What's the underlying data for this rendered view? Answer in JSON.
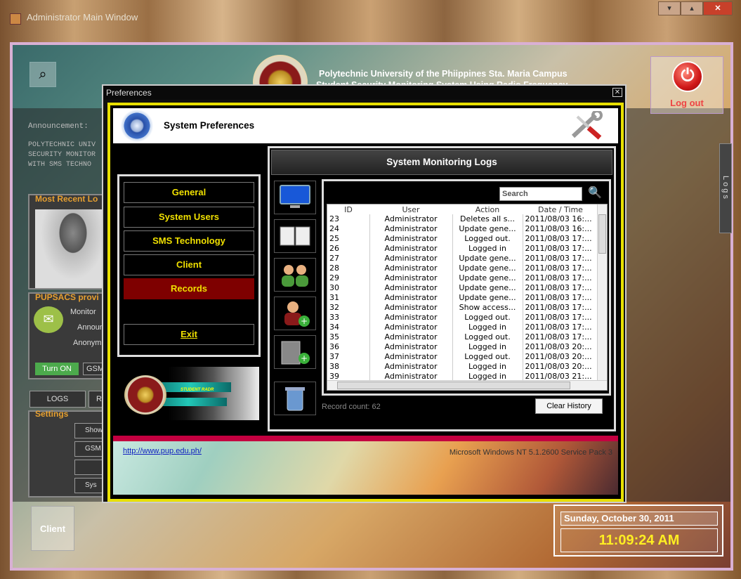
{
  "main_window": {
    "title": "Administrator Main Window",
    "controls": {
      "minimize": "▾",
      "maximize": "▴",
      "close": "✕"
    }
  },
  "header": {
    "line1": "Polytechnic University of the Phiippines Sta. Maria Campus",
    "line2": "Student Security Monitoring System Using Radio Frequency",
    "logout_label": "Log out",
    "logout_icon": "power-icon"
  },
  "left_panels": {
    "announcement_label": "Announcement:",
    "announcement_text": [
      "POLYTECHNIC UNIV",
      "SECURITY MONITOR",
      "WITH SMS TECHNO"
    ],
    "recent_title": "Most Recent Lo",
    "pupsacs_title": "PUPSACS provi",
    "pupsacs_labels": [
      "Monitor",
      "Announ",
      "Anonym"
    ],
    "turn_on_label": "Turn ON",
    "gsm_label": "GSM",
    "logs_tab": "LOGS",
    "r_tab": "R",
    "settings_title": "Settings",
    "settings_buttons": [
      "Show",
      "GSM M",
      "",
      "Sys"
    ]
  },
  "client_label": "Client",
  "logs_side_tab": "Logs",
  "clock": {
    "date": "Sunday, October 30, 2011",
    "time": "11:09:24 AM"
  },
  "preferences": {
    "title": "Preferences",
    "close_glyph": "✕",
    "header_title": "System Preferences",
    "menu": [
      {
        "label": "General",
        "active": false
      },
      {
        "label": "System Users",
        "active": false
      },
      {
        "label": "SMS Technology",
        "active": false
      },
      {
        "label": "Client",
        "active": false
      },
      {
        "label": "Records",
        "active": true
      }
    ],
    "exit_label": "Exit",
    "logo_caption": "STUDENT RADR",
    "logs_title": "System Monitoring Logs",
    "search_placeholder": "Search",
    "columns": [
      "ID",
      "User",
      "Action",
      "Date / Time"
    ],
    "rows": [
      [
        "23",
        "Administrator",
        "Deletes all s...",
        "2011/08/03 16:..."
      ],
      [
        "24",
        "Administrator",
        "Update gene...",
        "2011/08/03 16:..."
      ],
      [
        "25",
        "Administrator",
        "Logged out.",
        "2011/08/03 17:..."
      ],
      [
        "26",
        "Administrator",
        "Logged in",
        "2011/08/03 17:..."
      ],
      [
        "27",
        "Administrator",
        "Update gene...",
        "2011/08/03 17:..."
      ],
      [
        "28",
        "Administrator",
        "Update gene...",
        "2011/08/03 17:..."
      ],
      [
        "29",
        "Administrator",
        "Update gene...",
        "2011/08/03 17:..."
      ],
      [
        "30",
        "Administrator",
        "Update gene...",
        "2011/08/03 17:..."
      ],
      [
        "31",
        "Administrator",
        "Update gene...",
        "2011/08/03 17:..."
      ],
      [
        "32",
        "Administrator",
        "Show access...",
        "2011/08/03 17:..."
      ],
      [
        "33",
        "Administrator",
        "Logged out.",
        "2011/08/03 17:..."
      ],
      [
        "34",
        "Administrator",
        "Logged in",
        "2011/08/03 17:..."
      ],
      [
        "35",
        "Administrator",
        "Logged out.",
        "2011/08/03 17:..."
      ],
      [
        "36",
        "Administrator",
        "Logged in",
        "2011/08/03 20:..."
      ],
      [
        "37",
        "Administrator",
        "Logged out.",
        "2011/08/03 20:..."
      ],
      [
        "38",
        "Administrator",
        "Logged in",
        "2011/08/03 20:..."
      ],
      [
        "39",
        "Administrator",
        "Logged in",
        "2011/08/03 21:..."
      ]
    ],
    "record_count": "Record count: 62",
    "clear_history_label": "Clear History",
    "tool_icons": [
      "monitor-icon",
      "book-icon",
      "user-group-icon",
      "add-user-icon",
      "add-building-icon",
      "recycle-bin-icon"
    ],
    "link": "http://www.pup.edu.ph/",
    "os_info": "Microsoft Windows NT 5.1.2600 Service Pack 3"
  }
}
